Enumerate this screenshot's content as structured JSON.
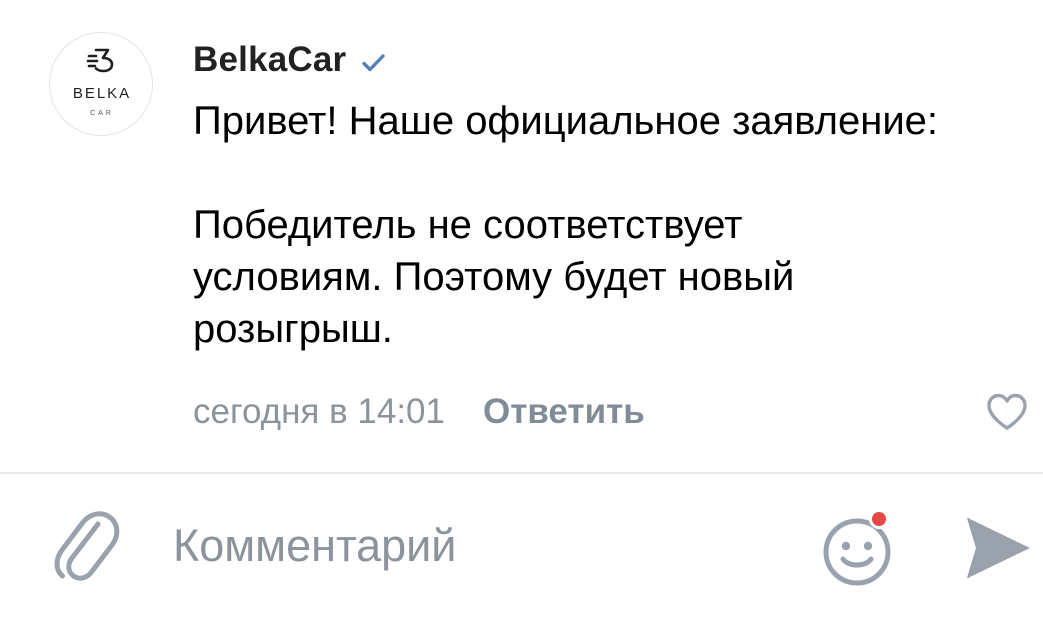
{
  "comment": {
    "author": {
      "name": "BelkaCar",
      "verified": true,
      "avatar": {
        "logo_text": "BELKA",
        "logo_subtext": "CAR"
      }
    },
    "text_lines": [
      "Привет! Наше официальное заявление:",
      "",
      "Победитель не соответствует",
      "условиям. Поэтому будет новый",
      "розыгрыш."
    ],
    "timestamp": "сегодня в 14:01",
    "reply_label": "Ответить",
    "liked": false
  },
  "composer": {
    "placeholder": "Комментарий",
    "value": "",
    "emoji_has_notification": true
  },
  "colors": {
    "text_primary": "#000000",
    "text_secondary": "#818c99",
    "icon": "#99a2ad",
    "verified": "#5181b8",
    "notification_dot": "#e64646",
    "divider": "#e7e8ec"
  },
  "icons": {
    "verified": "checkmark-icon",
    "like": "heart-outline-icon",
    "attach": "paperclip-icon",
    "emoji": "smile-icon",
    "send": "send-arrow-icon"
  }
}
